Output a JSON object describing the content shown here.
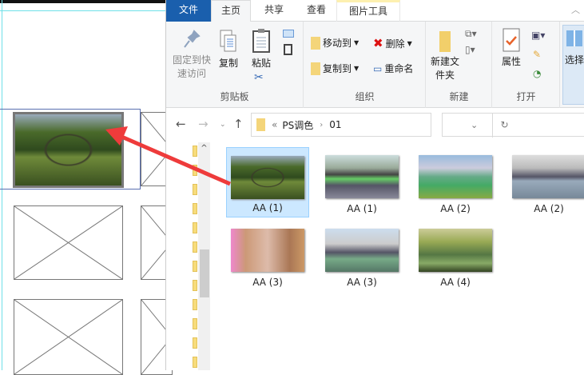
{
  "ribbon_tabs": [
    {
      "label": "文件"
    },
    {
      "label": "主页"
    },
    {
      "label": "共享"
    },
    {
      "label": "查看"
    },
    {
      "label": "图片工具"
    }
  ],
  "clipboard": {
    "pin": "固定到快速访问",
    "copy": "复制",
    "paste": "粘贴",
    "label": "剪贴板"
  },
  "organize": {
    "move_to": "移动到",
    "copy_to": "复制到",
    "delete": "删除",
    "rename": "重命名",
    "label": "组织"
  },
  "new": {
    "new_folder": "新建文件夹",
    "label": "新建"
  },
  "open": {
    "properties": "属性",
    "label": "打开"
  },
  "select": {
    "label": "选择"
  },
  "address": {
    "prefix": "«",
    "path": [
      "PS调色",
      "01"
    ]
  },
  "files": [
    {
      "name": "AA (1)",
      "selected": true
    },
    {
      "name": "AA (1)"
    },
    {
      "name": "AA (2)"
    },
    {
      "name": "AA (2)"
    },
    {
      "name": "AA (3)"
    },
    {
      "name": "AA (3)"
    },
    {
      "name": "AA (4)"
    }
  ],
  "colors": {
    "accent": "#1a5fad",
    "selection": "#cce8ff",
    "arrow": "#ee3b3b"
  }
}
